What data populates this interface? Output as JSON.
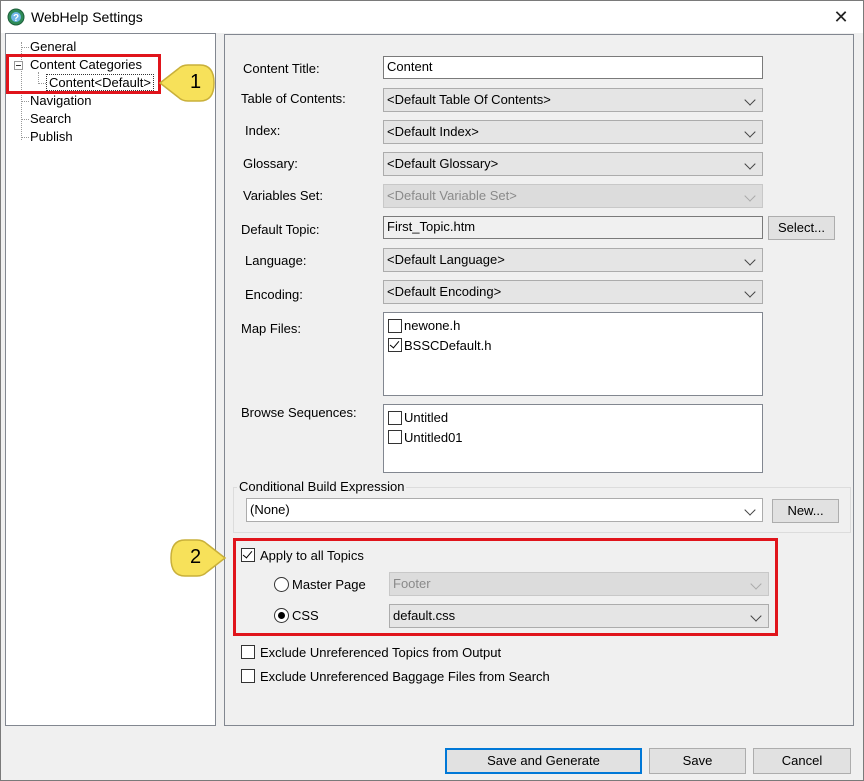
{
  "window": {
    "title": "WebHelp Settings",
    "close_symbol": "✕"
  },
  "tree": {
    "general": "General",
    "content_categories": "Content Categories",
    "content_default": "Content<Default>",
    "navigation": "Navigation",
    "search": "Search",
    "publish": "Publish"
  },
  "form": {
    "content_title_label": "Content Title:",
    "content_title_value": "Content",
    "toc_label": "Table of Contents:",
    "toc_value": "<Default Table Of Contents>",
    "index_label": "Index:",
    "index_value": "<Default Index>",
    "glossary_label": "Glossary:",
    "glossary_value": "<Default Glossary>",
    "variables_label": "Variables Set:",
    "variables_value": "<Default Variable Set>",
    "default_topic_label": "Default Topic:",
    "default_topic_value": "First_Topic.htm",
    "select_button": "Select...",
    "language_label": "Language:",
    "language_value": "<Default Language>",
    "encoding_label": "Encoding:",
    "encoding_value": "<Default Encoding>",
    "map_files_label": "Map Files:",
    "map_files": [
      {
        "name": "newone.h",
        "checked": false
      },
      {
        "name": "BSSCDefault.h",
        "checked": true
      }
    ],
    "browse_label": "Browse Sequences:",
    "browse_sequences": [
      {
        "name": "Untitled",
        "checked": false
      },
      {
        "name": "Untitled01",
        "checked": false
      }
    ],
    "cbe_label": "Conditional Build Expression",
    "cbe_value": "(None)",
    "new_button": "New...",
    "apply_all_label": "Apply to all Topics",
    "master_page_label": "Master Page",
    "master_page_value": "Footer",
    "css_label": "CSS",
    "css_value": "default.css",
    "exclude_topics_label": "Exclude Unreferenced Topics from Output",
    "exclude_baggage_label": "Exclude Unreferenced Baggage Files from Search"
  },
  "footer": {
    "save_generate": "Save and Generate",
    "save": "Save",
    "cancel": "Cancel"
  },
  "annotations": {
    "callout_1": "1",
    "callout_2": "2"
  },
  "colors": {
    "highlight_red": "#e0141b",
    "callout_yellow": "#f7e15a",
    "default_button_blue": "#0078d7"
  }
}
